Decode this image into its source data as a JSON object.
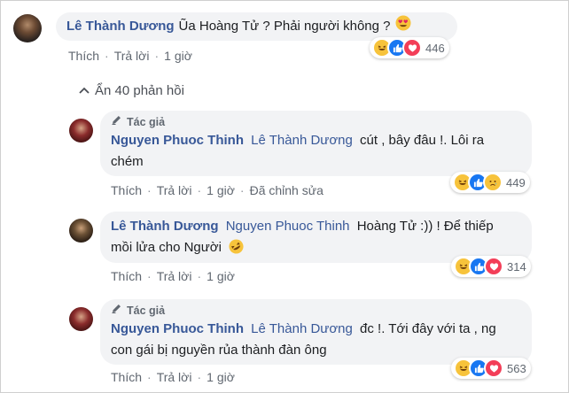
{
  "comments": [
    {
      "author": "Lê Thành Dương",
      "text": "Ũa Hoàng Tử ? Phải người không ?",
      "actions": {
        "like": "Thích",
        "reply": "Trả lời",
        "time": "1 giờ"
      },
      "reaction_count": "446"
    },
    {
      "author_tag": "Tác giả",
      "author": "Nguyen Phuoc Thinh",
      "mention": "Lê Thành Dương",
      "text_line1": "cút , bây đâu !. Lôi ra",
      "text_line2": "chém",
      "actions": {
        "like": "Thích",
        "reply": "Trả lời",
        "time": "1 giờ",
        "edited": "Đã chỉnh sửa"
      },
      "reaction_count": "449"
    },
    {
      "author": "Lê Thành Dương",
      "mention": "Nguyen Phuoc Thinh",
      "text_line1": "Hoàng Tử :)) ! Để thiếp",
      "text_line2": "mồi lửa cho Người",
      "actions": {
        "like": "Thích",
        "reply": "Trả lời",
        "time": "1 giờ"
      },
      "reaction_count": "314"
    },
    {
      "author_tag": "Tác giả",
      "author": "Nguyen Phuoc Thinh",
      "mention": "Lê Thành Dương",
      "text_line1": "đc !. Tới đây với ta , ng",
      "text_line2": "con gái bị nguyền rủa thành đàn ông",
      "actions": {
        "like": "Thích",
        "reply": "Trả lời",
        "time": "1 giờ"
      },
      "reaction_count": "563"
    }
  ],
  "hide_replies_label": "Ẩn 40 phản hồi",
  "colors": {
    "name": "#385898",
    "bubble": "#f2f3f5",
    "meta": "#606770",
    "like": "#1877f2",
    "love": "#f33e58",
    "haha": "#f7c33b"
  }
}
